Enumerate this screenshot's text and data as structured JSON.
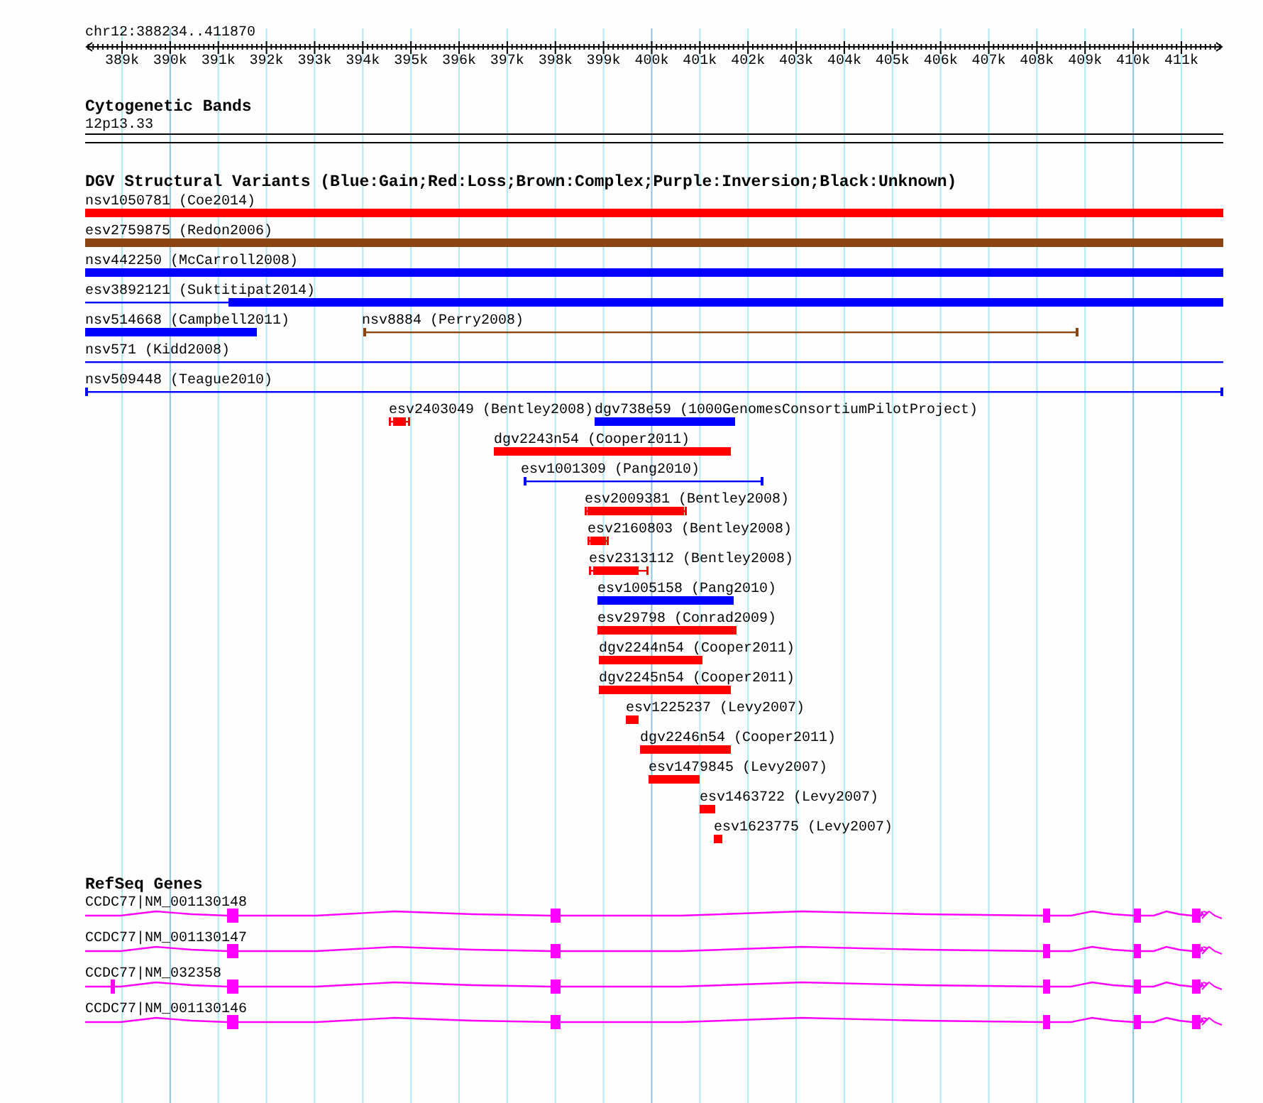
{
  "locus": "chr12:388234..411870",
  "ruler": {
    "ticks": [
      "389k",
      "390k",
      "391k",
      "392k",
      "393k",
      "394k",
      "395k",
      "396k",
      "397k",
      "398k",
      "399k",
      "400k",
      "401k",
      "402k",
      "403k",
      "404k",
      "405k",
      "406k",
      "407k",
      "408k",
      "409k",
      "410k",
      "411k"
    ]
  },
  "cytogenetic_bands": {
    "title": "Cytogenetic Bands",
    "bands": [
      {
        "label": "12p13.33"
      }
    ]
  },
  "dgv_variants": {
    "title": "DGV Structural Variants (Blue:Gain;Red:Loss;Brown:Complex;Purple:Inversion;Black:Unknown)",
    "features": [
      {
        "label": "nsv1050781 (Coe2014)",
        "kind": "bar",
        "color": "#ff0000"
      },
      {
        "label": "esv2759875 (Redon2006)",
        "kind": "bar",
        "color": "#8b4513"
      },
      {
        "label": "nsv442250 (McCarroll2008)",
        "kind": "bar",
        "color": "#0000ff"
      },
      {
        "label": "esv3892121 (Suktitipat2014)",
        "kind": "partial",
        "color": "#0000ff"
      },
      {
        "label": "nsv514668 (Campbell2011)",
        "kind": "bar",
        "color": "#0000ff"
      },
      {
        "label": "nsv8884 (Perry2008)",
        "kind": "span",
        "color": "#8b4513"
      },
      {
        "label": "nsv571 (Kidd2008)",
        "kind": "line",
        "color": "#0000ff"
      },
      {
        "label": "nsv509448 (Teague2010)",
        "kind": "span",
        "color": "#0000ff"
      },
      {
        "label": "esv2403049 (Bentley2008)",
        "kind": "dumbbell",
        "color": "#ff0000"
      },
      {
        "label": "dgv738e59 (1000GenomesConsortiumPilotProject)",
        "kind": "bar",
        "color": "#0000ff"
      },
      {
        "label": "dgv2243n54 (Cooper2011)",
        "kind": "bar",
        "color": "#ff0000"
      },
      {
        "label": "esv1001309 (Pang2010)",
        "kind": "span",
        "color": "#0000ff"
      },
      {
        "label": "esv2009381 (Bentley2008)",
        "kind": "dumbbell",
        "color": "#ff0000"
      },
      {
        "label": "esv2160803 (Bentley2008)",
        "kind": "dumbbell",
        "color": "#ff0000"
      },
      {
        "label": "esv2313112 (Bentley2008)",
        "kind": "dumbbell",
        "color": "#ff0000"
      },
      {
        "label": "esv1005158 (Pang2010)",
        "kind": "bar",
        "color": "#0000ff"
      },
      {
        "label": "esv29798 (Conrad2009)",
        "kind": "bar",
        "color": "#ff0000"
      },
      {
        "label": "dgv2244n54 (Cooper2011)",
        "kind": "bar",
        "color": "#ff0000"
      },
      {
        "label": "dgv2245n54 (Cooper2011)",
        "kind": "bar",
        "color": "#ff0000"
      },
      {
        "label": "esv1225237 (Levy2007)",
        "kind": "bar",
        "color": "#ff0000"
      },
      {
        "label": "dgv2246n54 (Cooper2011)",
        "kind": "bar",
        "color": "#ff0000"
      },
      {
        "label": "esv1479845 (Levy2007)",
        "kind": "bar",
        "color": "#ff0000"
      },
      {
        "label": "esv1463722 (Levy2007)",
        "kind": "bar",
        "color": "#ff0000"
      },
      {
        "label": "esv1623775 (Levy2007)",
        "kind": "bar",
        "color": "#ff0000"
      }
    ]
  },
  "refseq_genes": {
    "title": "RefSeq Genes",
    "transcripts": [
      {
        "label": "CCDC77|NM_001130148"
      },
      {
        "label": "CCDC77|NM_001130147"
      },
      {
        "label": "CCDC77|NM_032358"
      },
      {
        "label": "CCDC77|NM_001130146"
      }
    ]
  }
}
